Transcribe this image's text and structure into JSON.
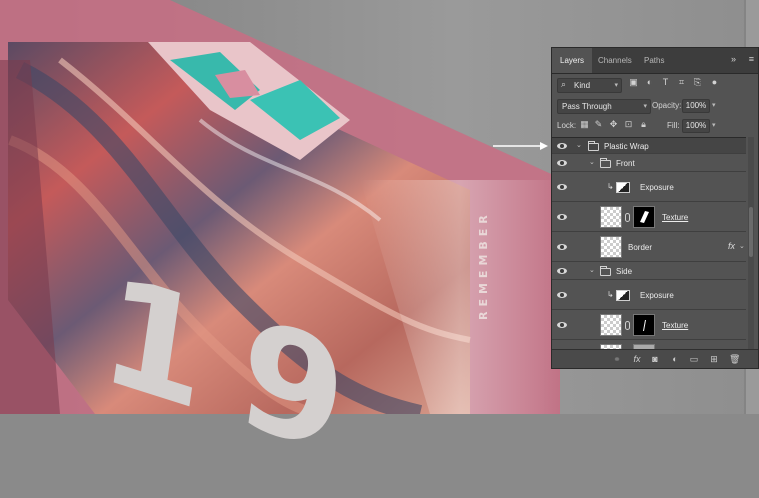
{
  "canvas": {
    "side_text": "REMEMBER",
    "big_text": "19",
    "colors": {
      "pink": "#d96b86",
      "teal": "#3dbfb0",
      "background": "#8a8a8a"
    }
  },
  "panel": {
    "tabs": [
      {
        "label": "Layers",
        "active": true
      },
      {
        "label": "Channels",
        "active": false
      },
      {
        "label": "Paths",
        "active": false
      }
    ],
    "collapse_icon": "double-chevron-right-icon",
    "menu_icon": "panel-menu-icon",
    "filter": {
      "label": "Kind",
      "icons": [
        "pixel-filter-icon",
        "adjustment-filter-icon",
        "type-filter-icon",
        "shape-filter-icon",
        "smart-object-filter-icon",
        "filter-toggle-icon"
      ]
    },
    "blend_mode": "Pass Through",
    "opacity_label": "Opacity:",
    "opacity_value": "100%",
    "lock_label": "Lock:",
    "fill_label": "Fill:",
    "fill_value": "100%",
    "layers": [
      {
        "name": "Plastic Wrap",
        "type": "group",
        "indent": 0,
        "expanded": true,
        "selected": true
      },
      {
        "name": "Front",
        "type": "group",
        "indent": 1,
        "expanded": true
      },
      {
        "name": "Exposure",
        "type": "adjustment",
        "indent": 2,
        "clipped": true
      },
      {
        "name": "Texture",
        "type": "smart-object-mask",
        "indent": 2,
        "linked": true
      },
      {
        "name": "Border",
        "type": "smart-object",
        "indent": 2,
        "fx": true
      },
      {
        "name": "Side",
        "type": "group",
        "indent": 1,
        "expanded": true
      },
      {
        "name": "Exposure",
        "type": "adjustment",
        "indent": 2,
        "clipped": true
      },
      {
        "name": "Texture",
        "type": "smart-object-mask",
        "indent": 2,
        "linked": true
      }
    ],
    "fx_label": "fx",
    "bottom_icons": [
      "link-layers-icon",
      "add-style-icon",
      "add-mask-icon",
      "new-adjustment-icon",
      "new-group-icon",
      "new-layer-icon",
      "delete-layer-icon"
    ]
  }
}
